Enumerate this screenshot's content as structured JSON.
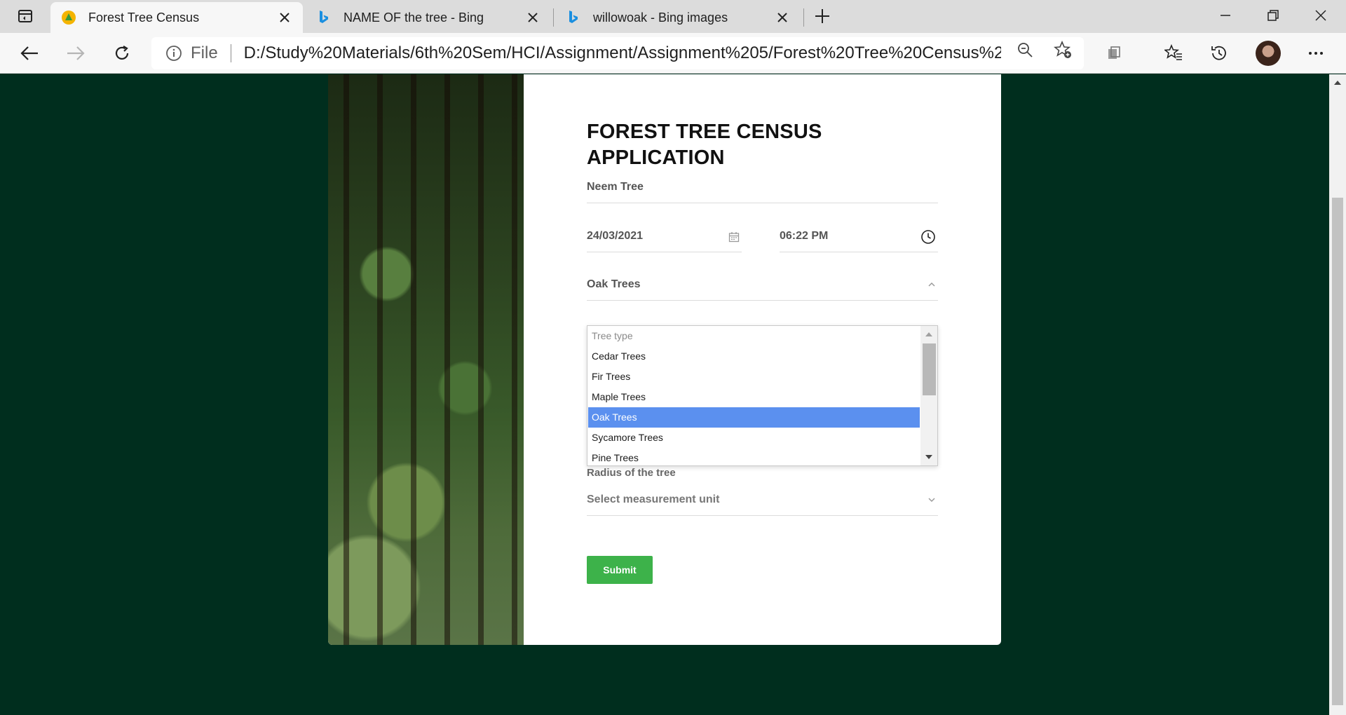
{
  "browser": {
    "tabs": [
      {
        "title": "Forest Tree Census",
        "icon": "forest-favicon",
        "active": true
      },
      {
        "title": "NAME OF the tree - Bing",
        "icon": "bing-icon",
        "active": false
      },
      {
        "title": "willowoak - Bing images",
        "icon": "bing-icon",
        "active": false
      }
    ],
    "address": {
      "scheme": "File",
      "url": "D:/Study%20Materials/6th%20Sem/HCI/Assignment/Assignment%205/Forest%20Tree%20Census%2..."
    }
  },
  "form": {
    "title": "FOREST TREE CENSUS APPLICATION",
    "tree_name": "Neem Tree",
    "date": "24/03/2021",
    "time": "06:22 PM",
    "tree_type_selected": "Oak Trees",
    "tree_type_options": [
      "Tree type",
      "Cedar Trees",
      "Fir Trees",
      "Maple Trees",
      "Oak Trees",
      "Sycamore Trees",
      "Pine Trees"
    ],
    "radius_label": "Radius of the tree",
    "unit_placeholder": "Select measurement unit",
    "submit_label": "Submit"
  },
  "colors": {
    "page_background": "#002e1e",
    "submit_button": "#3db24a",
    "selected_option": "#5b90ef"
  }
}
